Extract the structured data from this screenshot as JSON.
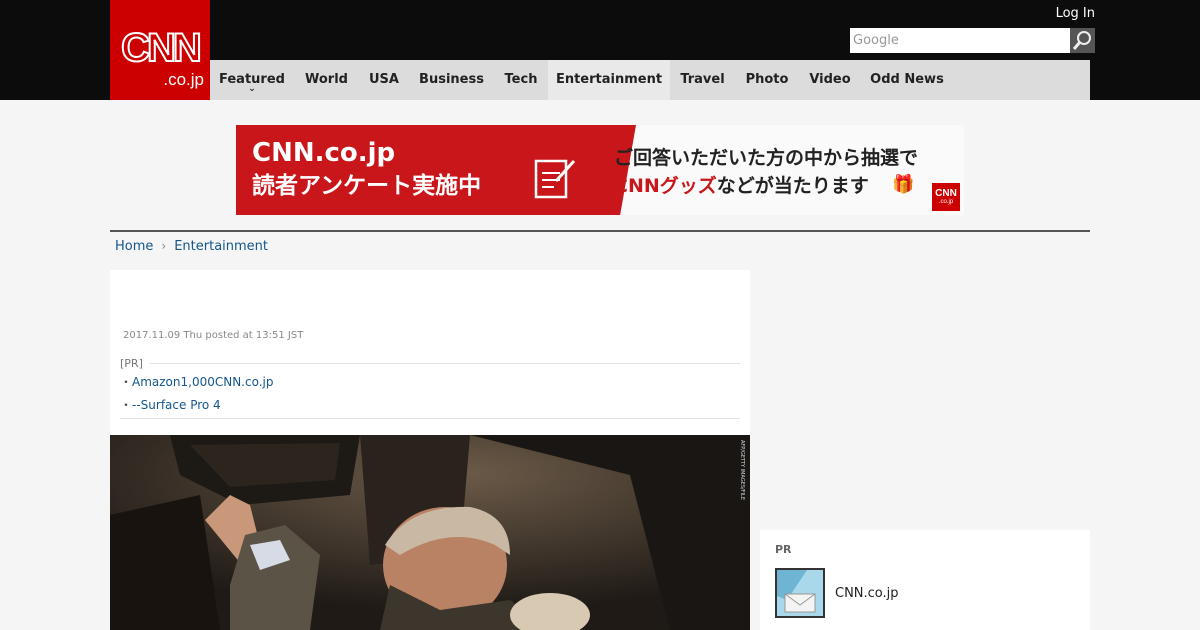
{
  "header": {
    "logo_main": "CNN",
    "logo_sub": ".co.jp",
    "login_label": "Log In",
    "search_placeholder": "Google",
    "search_icon": "magnifier-icon"
  },
  "nav": {
    "items": [
      {
        "label": "Featured",
        "has_dropdown": true
      },
      {
        "label": "World"
      },
      {
        "label": "USA"
      },
      {
        "label": "Business"
      },
      {
        "label": "Tech"
      },
      {
        "label": "Entertainment",
        "active": true
      },
      {
        "label": "Travel"
      },
      {
        "label": "Photo"
      },
      {
        "label": "Video"
      },
      {
        "label": "Odd News"
      }
    ],
    "dropdown_glyph": "⌄"
  },
  "banner": {
    "left_line1": "CNN.co.jp",
    "left_line2": "読者アンケート実施中",
    "right_line1": "ご回答いただいた方の中から抽選で",
    "right_line2_accent": "CNNグッズ",
    "right_line2_rest": "などが当たります",
    "badge_main": "CNN",
    "badge_sub": ".co.jp",
    "colors": {
      "red": "#c8161b"
    }
  },
  "breadcrumb": {
    "home": "Home",
    "separator": "›",
    "current": "Entertainment"
  },
  "article": {
    "posted": "2017.11.09 Thu posted at 13:51 JST",
    "pr_label": "[PR]",
    "pr_links": [
      "Amazon1,000CNN.co.jp",
      "--Surface Pro 4"
    ],
    "bullet": "・",
    "photo_credit": "AFP/GETTY IMAGES/FILE"
  },
  "sidebar": {
    "pr_label": "PR",
    "pr_item_text": "CNN.co.jp"
  },
  "colors": {
    "header_bg": "#0c0c0c",
    "brand_red": "#cc0000",
    "nav_bg": "#dcdcdc",
    "link": "#14568d"
  }
}
